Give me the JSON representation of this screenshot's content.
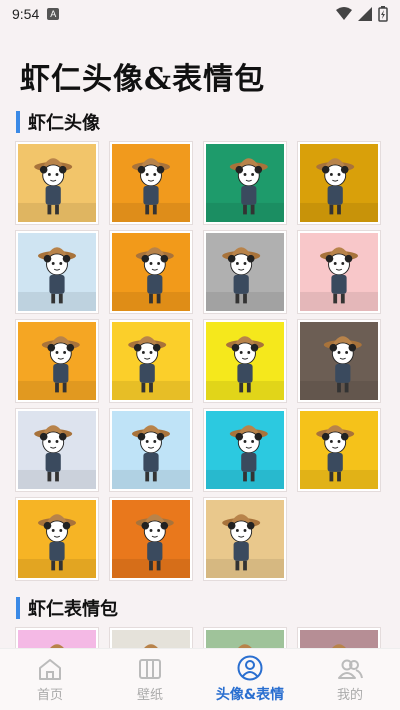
{
  "status": {
    "time": "9:54",
    "notif_letter": "A"
  },
  "page": {
    "title": "虾仁头像&表情包"
  },
  "sections": [
    {
      "title": "虾仁头像"
    },
    {
      "title": "虾仁表情包"
    }
  ],
  "avatars": [
    {
      "bg": "#f2c56a",
      "sub": "bicycle"
    },
    {
      "bg": "#f19a1d",
      "sub": "boy"
    },
    {
      "bg": "#1e9b6b",
      "sub": "walker"
    },
    {
      "bg": "#d9a00a",
      "sub": "coat"
    },
    {
      "bg": "#cfe4f2",
      "sub": "orange"
    },
    {
      "bg": "#f29a1a",
      "sub": "table"
    },
    {
      "bg": "#b0b0b0",
      "sub": "street"
    },
    {
      "bg": "#f8c7c9",
      "sub": "small"
    },
    {
      "bg": "#f5a623",
      "sub": "pointing"
    },
    {
      "bg": "#fbcf2a",
      "sub": "tiny"
    },
    {
      "bg": "#f5e81c",
      "sub": "shocked"
    },
    {
      "bg": "#6c5e54",
      "sub": "lion"
    },
    {
      "bg": "#dde3ee",
      "sub": "moon"
    },
    {
      "bg": "#bfe3f7",
      "sub": "splash"
    },
    {
      "bg": "#2cc9e0",
      "sub": "ghost"
    },
    {
      "bg": "#f5c21a",
      "sub": "muscle"
    },
    {
      "bg": "#f6b425",
      "sub": "burger"
    },
    {
      "bg": "#e9781c",
      "sub": "bath"
    },
    {
      "bg": "#e9c88c",
      "sub": "armor"
    }
  ],
  "stickers": [
    {
      "bg": "#f4b9e5"
    },
    {
      "bg": "#e5e2da"
    },
    {
      "bg": "#9fc39a"
    },
    {
      "bg": "#b68e95"
    }
  ],
  "nav": [
    {
      "label": "首页",
      "icon": "home-icon"
    },
    {
      "label": "壁纸",
      "icon": "book-icon"
    },
    {
      "label": "头像&表情",
      "icon": "user-icon"
    },
    {
      "label": "我的",
      "icon": "users-icon"
    }
  ]
}
